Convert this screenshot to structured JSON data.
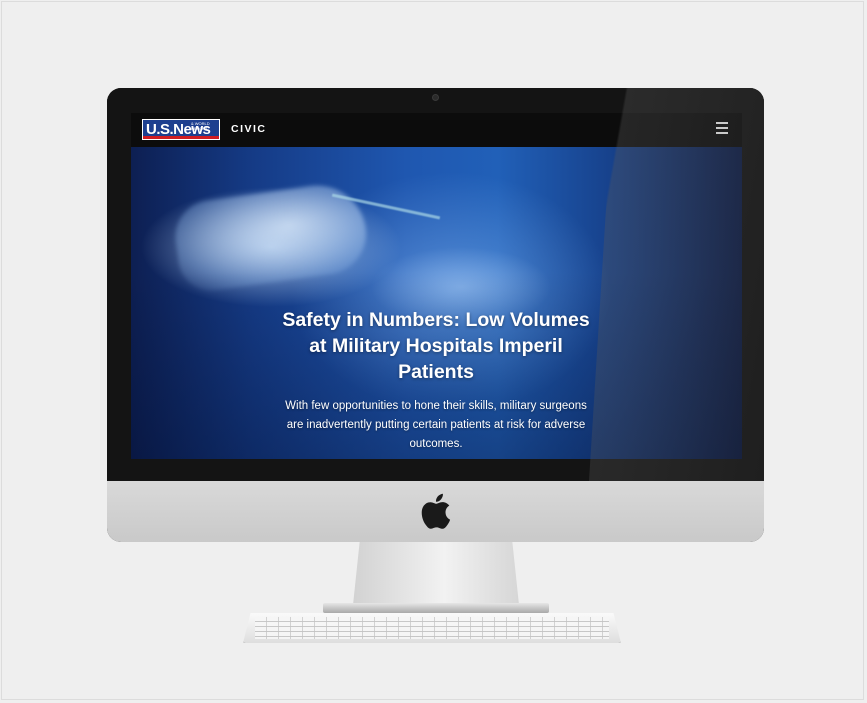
{
  "site": {
    "logo_text": "U.S.News",
    "logo_tagline": "& WORLD REPORT",
    "section": "CIVIC",
    "menu_icon": "hamburger-menu-icon"
  },
  "article": {
    "headline": "Safety in Numbers: Low Volumes at Military Hospitals Imperil Patients",
    "dek": "With few opportunities to hone their skills, military surgeons are inadvertently putting certain patients at risk for adverse outcomes."
  },
  "device": {
    "logo_icon": "apple-logo-icon"
  },
  "colors": {
    "nav_bg": "#0c0c0c",
    "brand_blue": "#1d3f8f",
    "brand_red": "#d01c22",
    "hero_blue": "#1f57b0",
    "background": "#efefef"
  }
}
